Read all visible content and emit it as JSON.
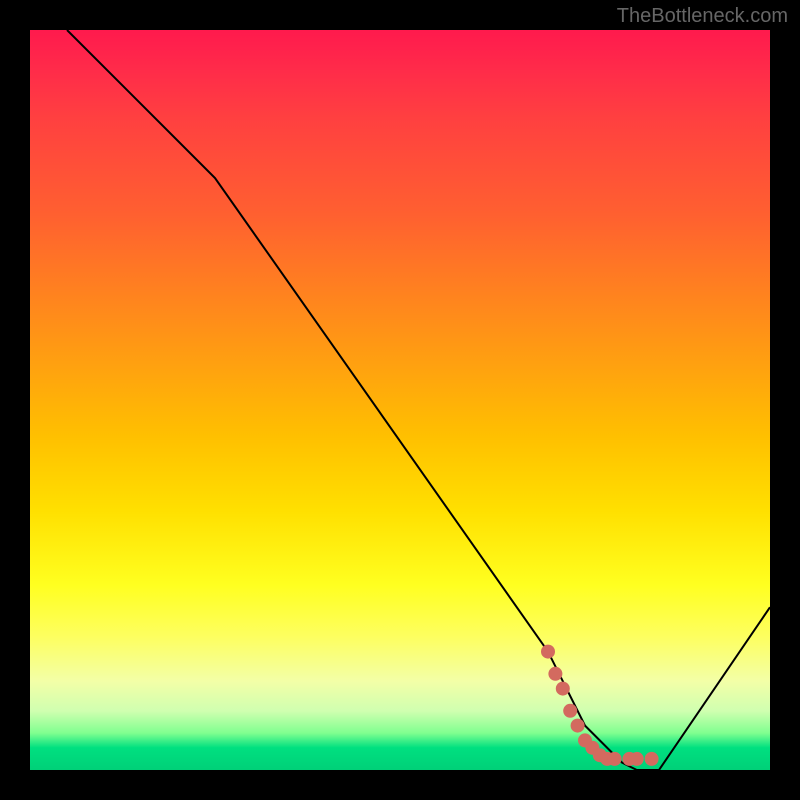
{
  "watermark": "TheBottleneck.com",
  "chart_data": {
    "type": "line",
    "title": "",
    "xlabel": "",
    "ylabel": "",
    "xlim": [
      0,
      100
    ],
    "ylim": [
      0,
      100
    ],
    "series": [
      {
        "name": "bottleneck-curve",
        "x": [
          5,
          25,
          70,
          75,
          80,
          82,
          85,
          100
        ],
        "y": [
          100,
          80,
          16,
          6,
          1,
          0,
          0,
          22
        ]
      }
    ],
    "highlight_points": {
      "name": "highlighted-segment",
      "color": "#d36a5f",
      "points": [
        {
          "x": 70,
          "y": 16
        },
        {
          "x": 71,
          "y": 13
        },
        {
          "x": 72,
          "y": 11
        },
        {
          "x": 73,
          "y": 8
        },
        {
          "x": 74,
          "y": 6
        },
        {
          "x": 75,
          "y": 4
        },
        {
          "x": 76,
          "y": 3
        },
        {
          "x": 77,
          "y": 2
        },
        {
          "x": 78,
          "y": 1.5
        },
        {
          "x": 79,
          "y": 1.5
        },
        {
          "x": 81,
          "y": 1.5
        },
        {
          "x": 82,
          "y": 1.5
        },
        {
          "x": 84,
          "y": 1.5
        }
      ]
    }
  }
}
